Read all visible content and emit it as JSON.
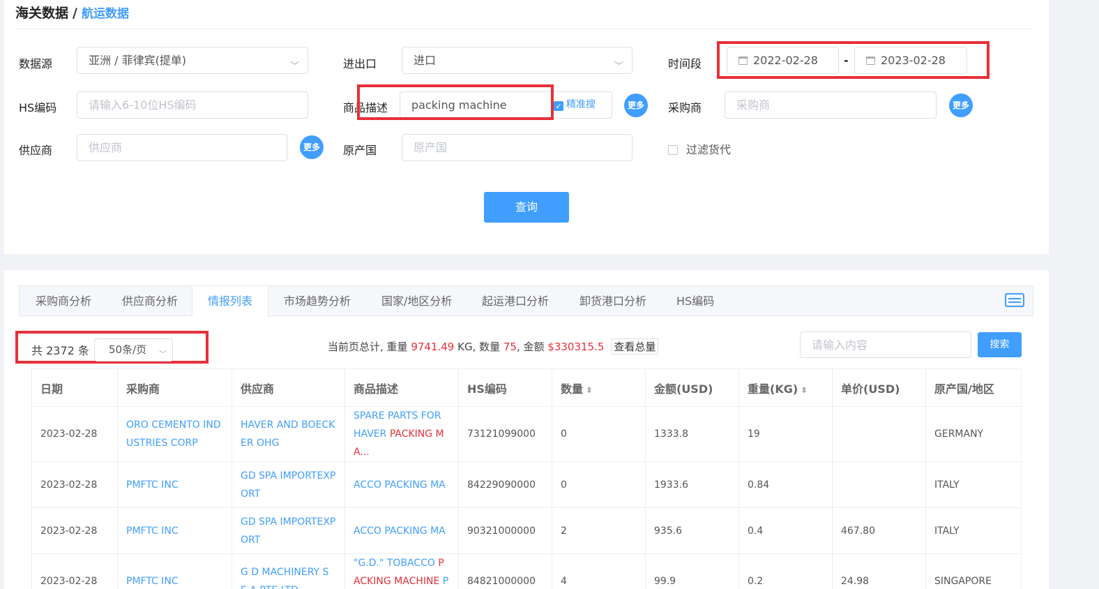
{
  "breadcrumb": {
    "root": "海关数据",
    "sep": "/",
    "current": "航运数据"
  },
  "filters": {
    "data_source_label": "数据源",
    "data_source_value": "亚洲 / 菲律宾(提单)",
    "direction_label": "进出口",
    "direction_value": "进口",
    "period_label": "时间段",
    "date_start": "2022-02-28",
    "date_sep": "-",
    "date_end": "2023-02-28",
    "hs_label": "HS编码",
    "hs_placeholder": "请输入6-10位HS编码",
    "desc_label": "商品描述",
    "desc_value": "packing machine",
    "exact_label": "精准搜",
    "buyer_label": "采购商",
    "buyer_placeholder": "采购商",
    "supplier_label": "供应商",
    "supplier_placeholder": "供应商",
    "origin_label": "原产国",
    "origin_placeholder": "原产国",
    "filter_forwarder_label": "过滤货代",
    "more_label": "更多",
    "query_label": "查询"
  },
  "tabs": [
    "采购商分析",
    "供应商分析",
    "情报列表",
    "市场趋势分析",
    "国家/地区分析",
    "起运港口分析",
    "卸货港口分析",
    "HS编码"
  ],
  "active_tab": "情报列表",
  "list": {
    "total_text": "共 2372 条",
    "page_size": "50条/页",
    "summary_prefix": "当前页总计, 重量 ",
    "weight": "9741.49",
    "weight_unit": " KG, 数量 ",
    "qty": "75",
    "amount_prefix": ", 金额 ",
    "amount": "$330315.5",
    "total_btn": "查看总量",
    "search_placeholder": "请输入内容",
    "search_btn": "搜索"
  },
  "table": {
    "headers": [
      "日期",
      "采购商",
      "供应商",
      "商品描述",
      "HS编码",
      "数量",
      "金额(USD)",
      "重量(KG)",
      "单价(USD)",
      "原产国/地区"
    ],
    "rows": [
      {
        "date": "2023-02-28",
        "buyer": "ORO CEMENTO INDUSTRIES CORP",
        "supplier": "HAVER AND BOECKER OHG",
        "desc_pre": "SPARE PARTS FOR HAVER ",
        "desc_hl": "PACKING MA...",
        "desc_post": "",
        "hs": "73121099000",
        "qty": "0",
        "amount": "1333.8",
        "weight": "19",
        "price": "",
        "origin": "GERMANY"
      },
      {
        "date": "2023-02-28",
        "buyer": "PMFTC INC",
        "supplier": "GD SPA IMPORTEXPORT",
        "desc_pre": "ACCO PACKING MA",
        "desc_hl": "",
        "desc_post": "",
        "hs": "84229090000",
        "qty": "0",
        "amount": "1933.6",
        "weight": "0.84",
        "price": "",
        "origin": "ITALY"
      },
      {
        "date": "2023-02-28",
        "buyer": "PMFTC INC",
        "supplier": "GD SPA IMPORTEXPORT",
        "desc_pre": "ACCO PACKING MA",
        "desc_hl": "",
        "desc_post": "",
        "hs": "90321000000",
        "qty": "2",
        "amount": "935.6",
        "weight": "0.4",
        "price": "467.80",
        "origin": "ITALY"
      },
      {
        "date": "2023-02-28",
        "buyer": "PMFTC INC",
        "supplier": "G D MACHINERY S E A PTE LTD",
        "desc_pre": "\"G.D.\" TOBACCO ",
        "desc_hl": "PACKING MACHINE",
        "desc_post": " PA...",
        "hs": "84821000000",
        "qty": "4",
        "amount": "99.9",
        "weight": "0.2",
        "price": "24.98",
        "origin": "SINGAPORE"
      }
    ]
  }
}
